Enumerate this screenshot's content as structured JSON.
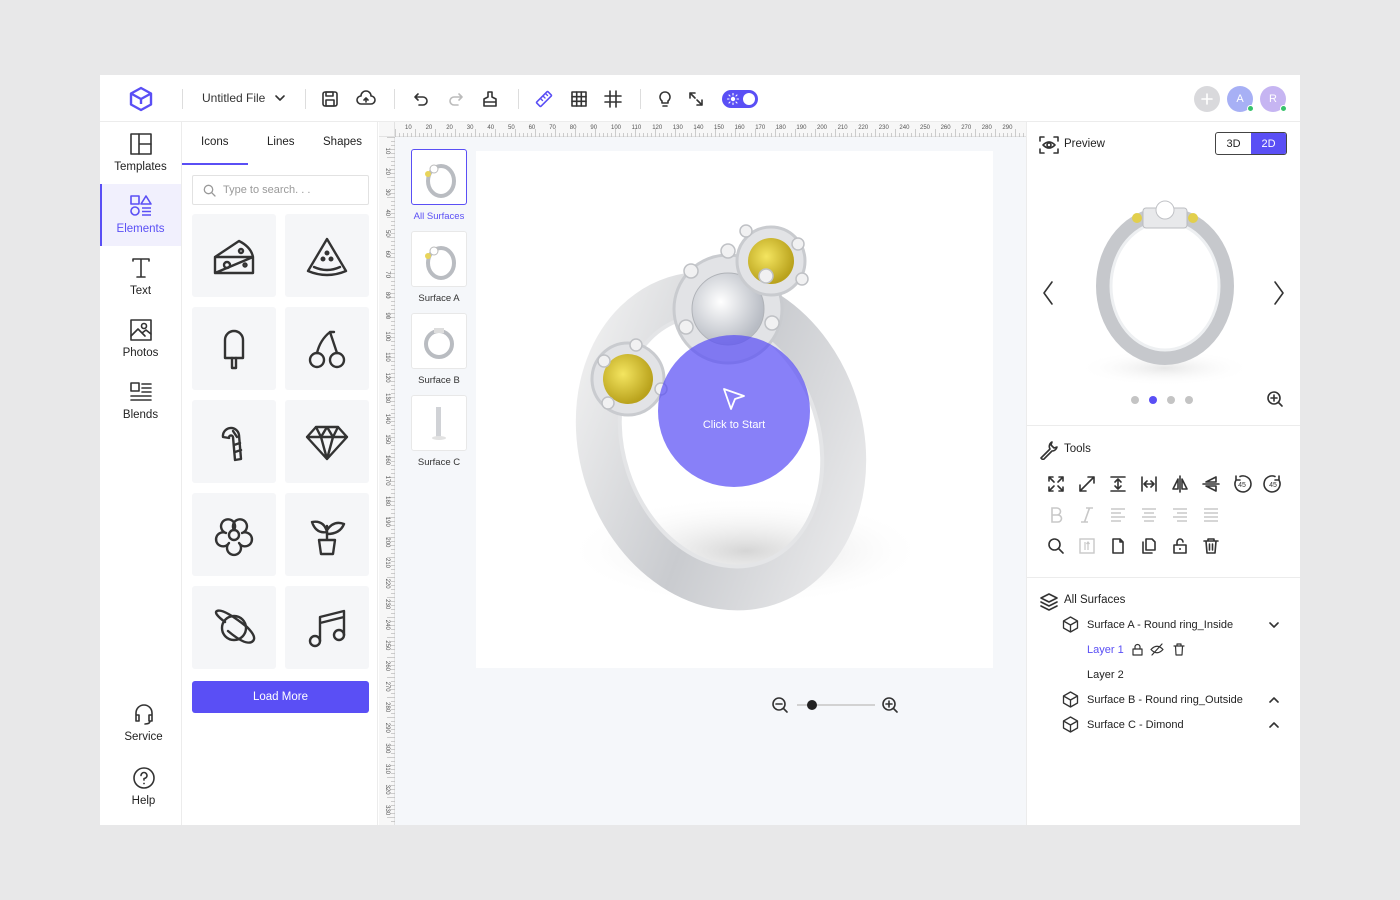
{
  "topbar": {
    "file_name": "Untitled File",
    "avatars": [
      {
        "letter": "",
        "color": "#d9d9dc"
      },
      {
        "letter": "A",
        "color": "#a7b0f5"
      },
      {
        "letter": "R",
        "color": "#c6b5f2"
      }
    ],
    "toggle_on": true
  },
  "rail": {
    "items": [
      {
        "label": "Templates",
        "icon": "templates-icon"
      },
      {
        "label": "Elements",
        "icon": "elements-icon",
        "active": true
      },
      {
        "label": "Text",
        "icon": "text-icon"
      },
      {
        "label": "Photos",
        "icon": "photos-icon"
      },
      {
        "label": "Blends",
        "icon": "blends-icon"
      }
    ],
    "bottom": [
      {
        "label": "Service",
        "icon": "headset-icon"
      },
      {
        "label": "Help",
        "icon": "help-icon"
      }
    ]
  },
  "panel": {
    "tabs": [
      "Icons",
      "Lines",
      "Shapes"
    ],
    "active_tab": "Icons",
    "search_placeholder": "Type to search. . .",
    "icons": [
      "cheese-icon",
      "watermelon-icon",
      "popsicle-icon",
      "cherry-icon",
      "candy-cane-icon",
      "diamond-icon",
      "flower-icon",
      "plant-icon",
      "planet-icon",
      "music-icon"
    ],
    "load_more": "Load More"
  },
  "ruler": {
    "top": [
      "10",
      "20",
      "20",
      "30",
      "40",
      "50",
      "60",
      "70",
      "80",
      "90",
      "100",
      "110",
      "120",
      "130",
      "140",
      "150",
      "160",
      "170",
      "180",
      "190",
      "200",
      "210",
      "220",
      "230",
      "240",
      "250",
      "260",
      "270",
      "280",
      "290"
    ],
    "left": [
      "10",
      "20",
      "30",
      "40",
      "50",
      "60",
      "70",
      "80",
      "90",
      "100",
      "110",
      "120",
      "130",
      "140",
      "150",
      "160",
      "170",
      "180",
      "190",
      "200",
      "210",
      "220",
      "230",
      "240",
      "250",
      "260",
      "270",
      "280",
      "290",
      "300",
      "310",
      "320",
      "330"
    ]
  },
  "surfaces": [
    {
      "label": "All Surfaces",
      "active": true
    },
    {
      "label": "Surface A"
    },
    {
      "label": "Surface B"
    },
    {
      "label": "Surface C"
    }
  ],
  "canvas": {
    "cta_label": "Click to Start"
  },
  "preview": {
    "title": "Preview",
    "modes": [
      "3D",
      "2D"
    ],
    "active_mode": "2D",
    "dot_count": 4,
    "active_dot": 1
  },
  "tools": {
    "title": "Tools",
    "rotate_a": "45",
    "rotate_b": "45"
  },
  "layers": {
    "title": "All Surfaces",
    "surfaces": [
      {
        "label": "Surface A - Round ring_Inside",
        "expanded": true,
        "layers": [
          "Layer 1",
          "Layer 2"
        ]
      },
      {
        "label": "Surface B - Round ring_Outside",
        "expanded": false
      },
      {
        "label": "Surface C - Dimond",
        "expanded": false
      }
    ]
  },
  "colors": {
    "accent": "#5a4ff5",
    "bg": "#e8e8e9",
    "canvas_bg": "#f5f7fa",
    "online": "#37c26b"
  }
}
